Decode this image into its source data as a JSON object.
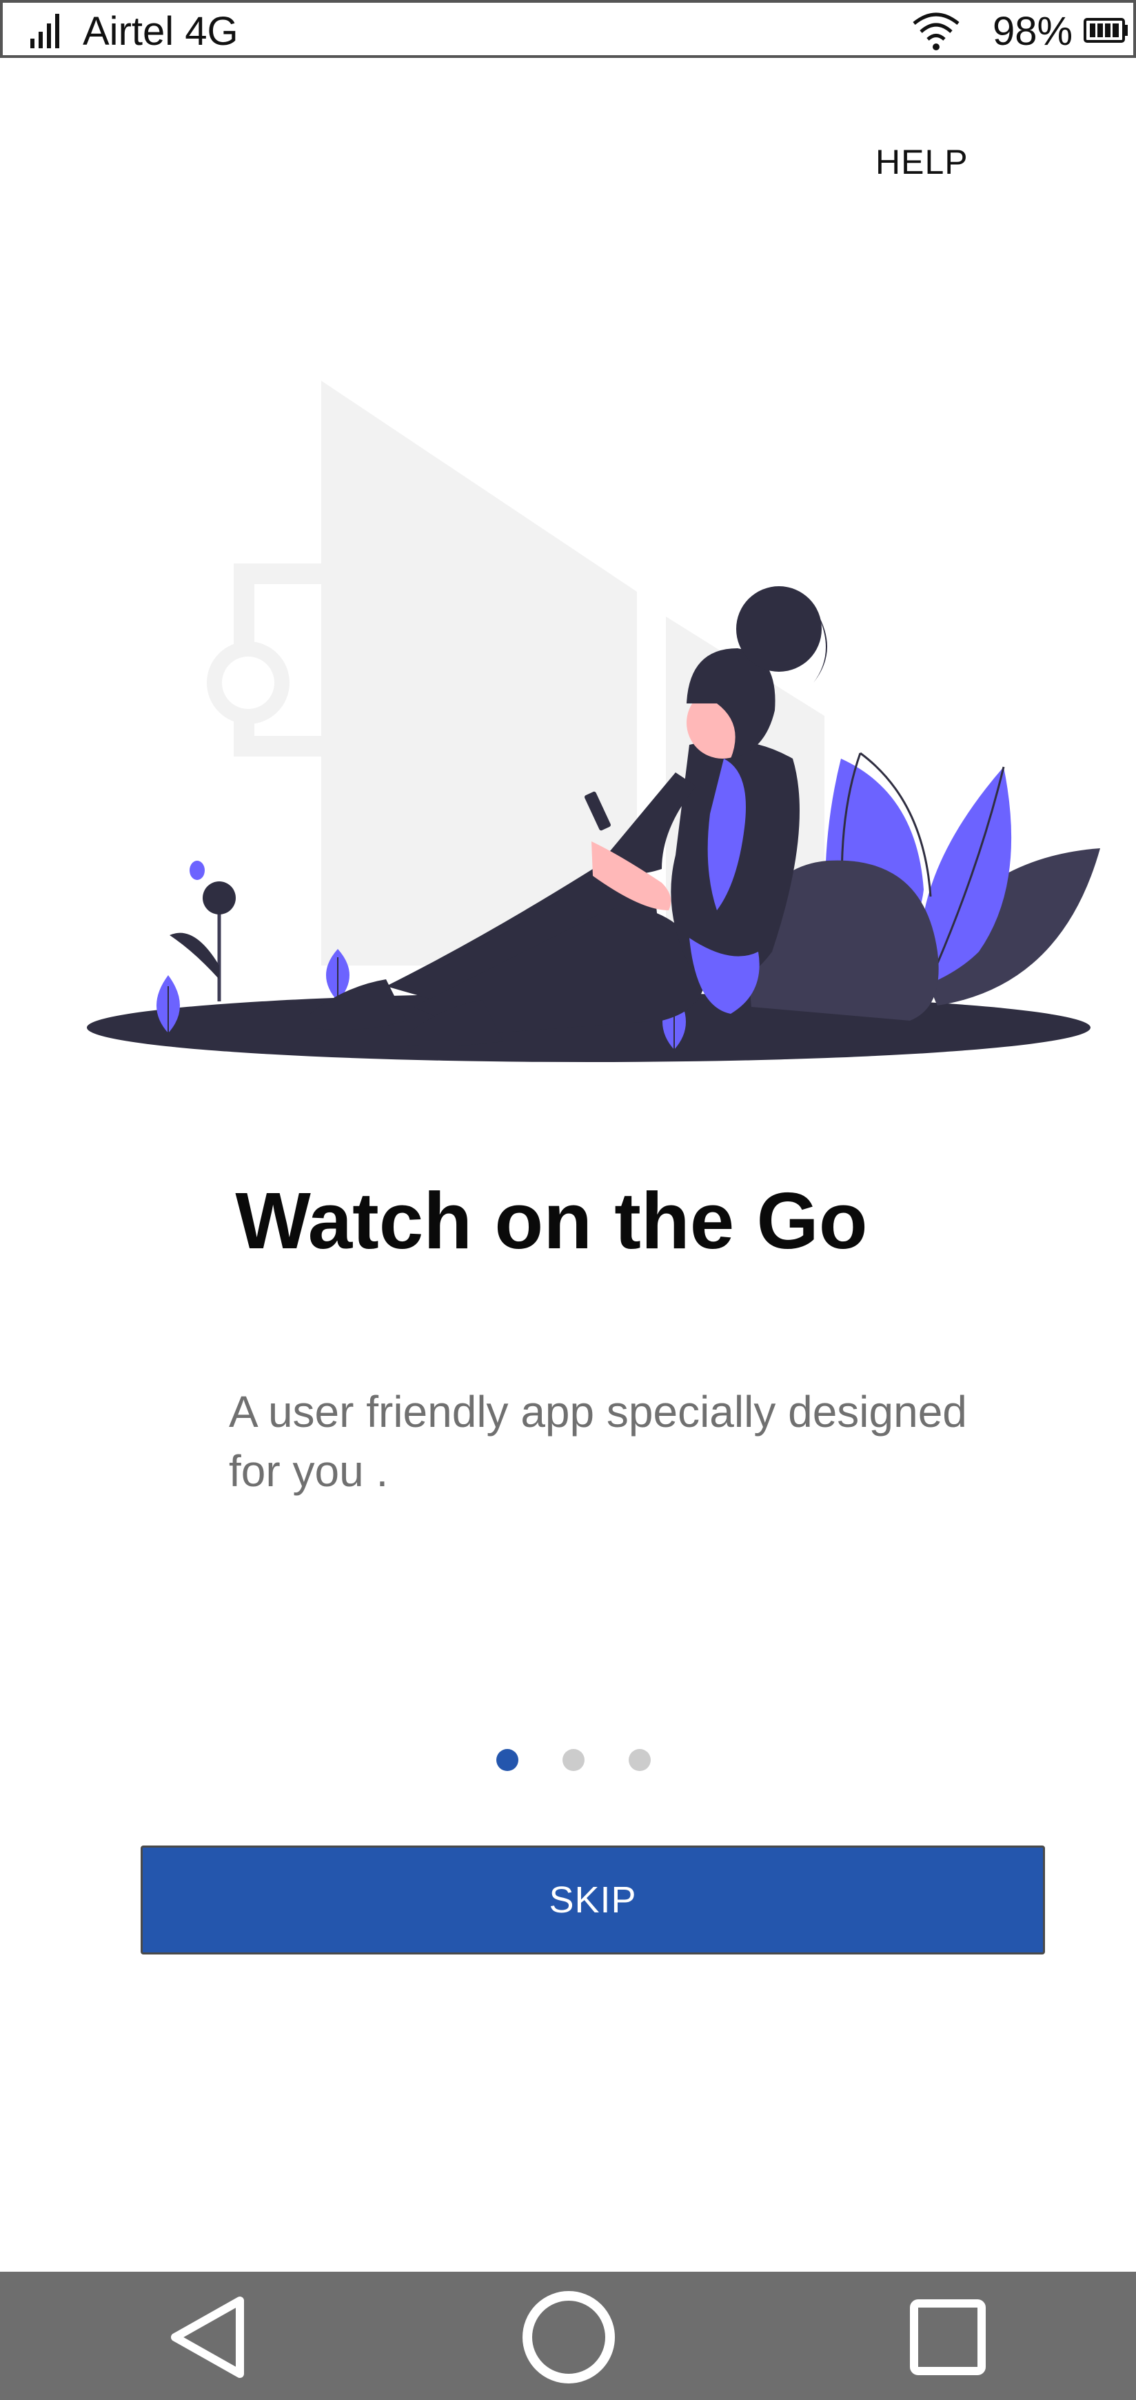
{
  "status_bar": {
    "carrier": "Airtel 4G",
    "battery": "98%",
    "icons": [
      "signal-icon",
      "wifi-icon",
      "battery-icon"
    ]
  },
  "header": {
    "help_label": "HELP"
  },
  "slide": {
    "title": "Watch on the Go",
    "description": "A user friendly app specially designed for you .",
    "illustration": "person-sitting-with-phone-illustration"
  },
  "pager": {
    "total": 3,
    "active_index": 0
  },
  "skip_button": {
    "label": "SKIP"
  },
  "nav_bar": {
    "icons": [
      "back-icon",
      "home-icon",
      "recents-icon"
    ]
  },
  "colors": {
    "primary": "#2456ad",
    "illustration_accent": "#6c63ff",
    "illustration_dark": "#2f2e41",
    "dot_inactive": "#cccccc",
    "description_text": "#707070",
    "nav_bar_bg": "#6e6e6e"
  }
}
